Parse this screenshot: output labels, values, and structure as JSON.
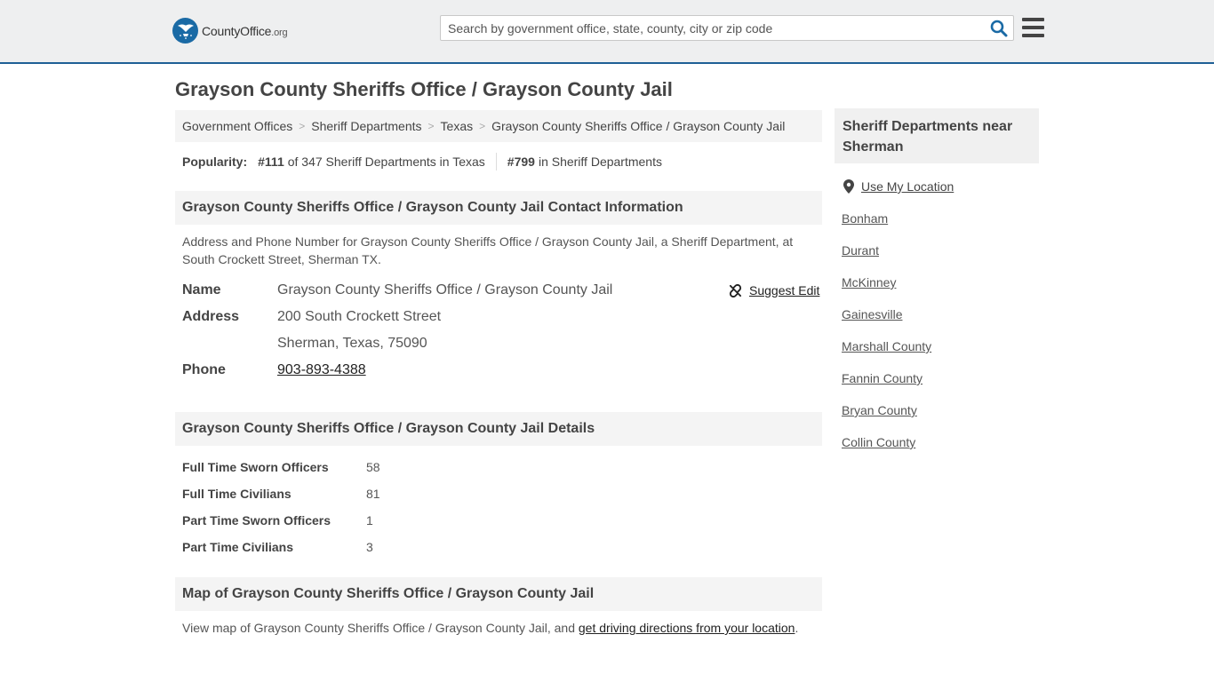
{
  "header": {
    "logo_text": "CountyOffice",
    "logo_suffix": ".org",
    "search_placeholder": "Search by government office, state, county, city or zip code"
  },
  "page": {
    "title": "Grayson County Sheriffs Office / Grayson County Jail"
  },
  "breadcrumb": [
    "Government Offices",
    "Sheriff Departments",
    "Texas",
    "Grayson County Sheriffs Office / Grayson County Jail"
  ],
  "popularity": {
    "label": "Popularity:",
    "state_rank": "#111",
    "state_text": "of 347 Sheriff Departments in Texas",
    "national_rank": "#799",
    "national_text": "in Sheriff Departments"
  },
  "contact": {
    "heading": "Grayson County Sheriffs Office / Grayson County Jail Contact Information",
    "description": "Address and Phone Number for Grayson County Sheriffs Office / Grayson County Jail, a Sheriff Department, at South Crockett Street, Sherman TX.",
    "name_label": "Name",
    "name_value": "Grayson County Sheriffs Office / Grayson County Jail",
    "address_label": "Address",
    "address_line1": "200 South Crockett Street",
    "address_line2": "Sherman, Texas, 75090",
    "phone_label": "Phone",
    "phone_value": "903-893-4388",
    "suggest_edit": "Suggest Edit"
  },
  "details": {
    "heading": "Grayson County Sheriffs Office / Grayson County Jail Details",
    "rows": [
      {
        "label": "Full Time Sworn Officers",
        "value": "58"
      },
      {
        "label": "Full Time Civilians",
        "value": "81"
      },
      {
        "label": "Part Time Sworn Officers",
        "value": "1"
      },
      {
        "label": "Part Time Civilians",
        "value": "3"
      }
    ]
  },
  "map": {
    "heading": "Map of Grayson County Sheriffs Office / Grayson County Jail",
    "text": "View map of Grayson County Sheriffs Office / Grayson County Jail, and",
    "link": "get driving directions from your location",
    "end": "."
  },
  "sidebar": {
    "heading": "Sheriff Departments near Sherman",
    "use_location": "Use My Location",
    "links": [
      "Bonham",
      "Durant",
      "McKinney",
      "Gainesville",
      "Marshall County",
      "Fannin County",
      "Bryan County",
      "Collin County"
    ]
  },
  "colors": {
    "header_bg": "#eeeff0",
    "header_border": "#1e5f95",
    "search_icon": "#1a6aa5",
    "section_bg": "#f4f4f4"
  }
}
